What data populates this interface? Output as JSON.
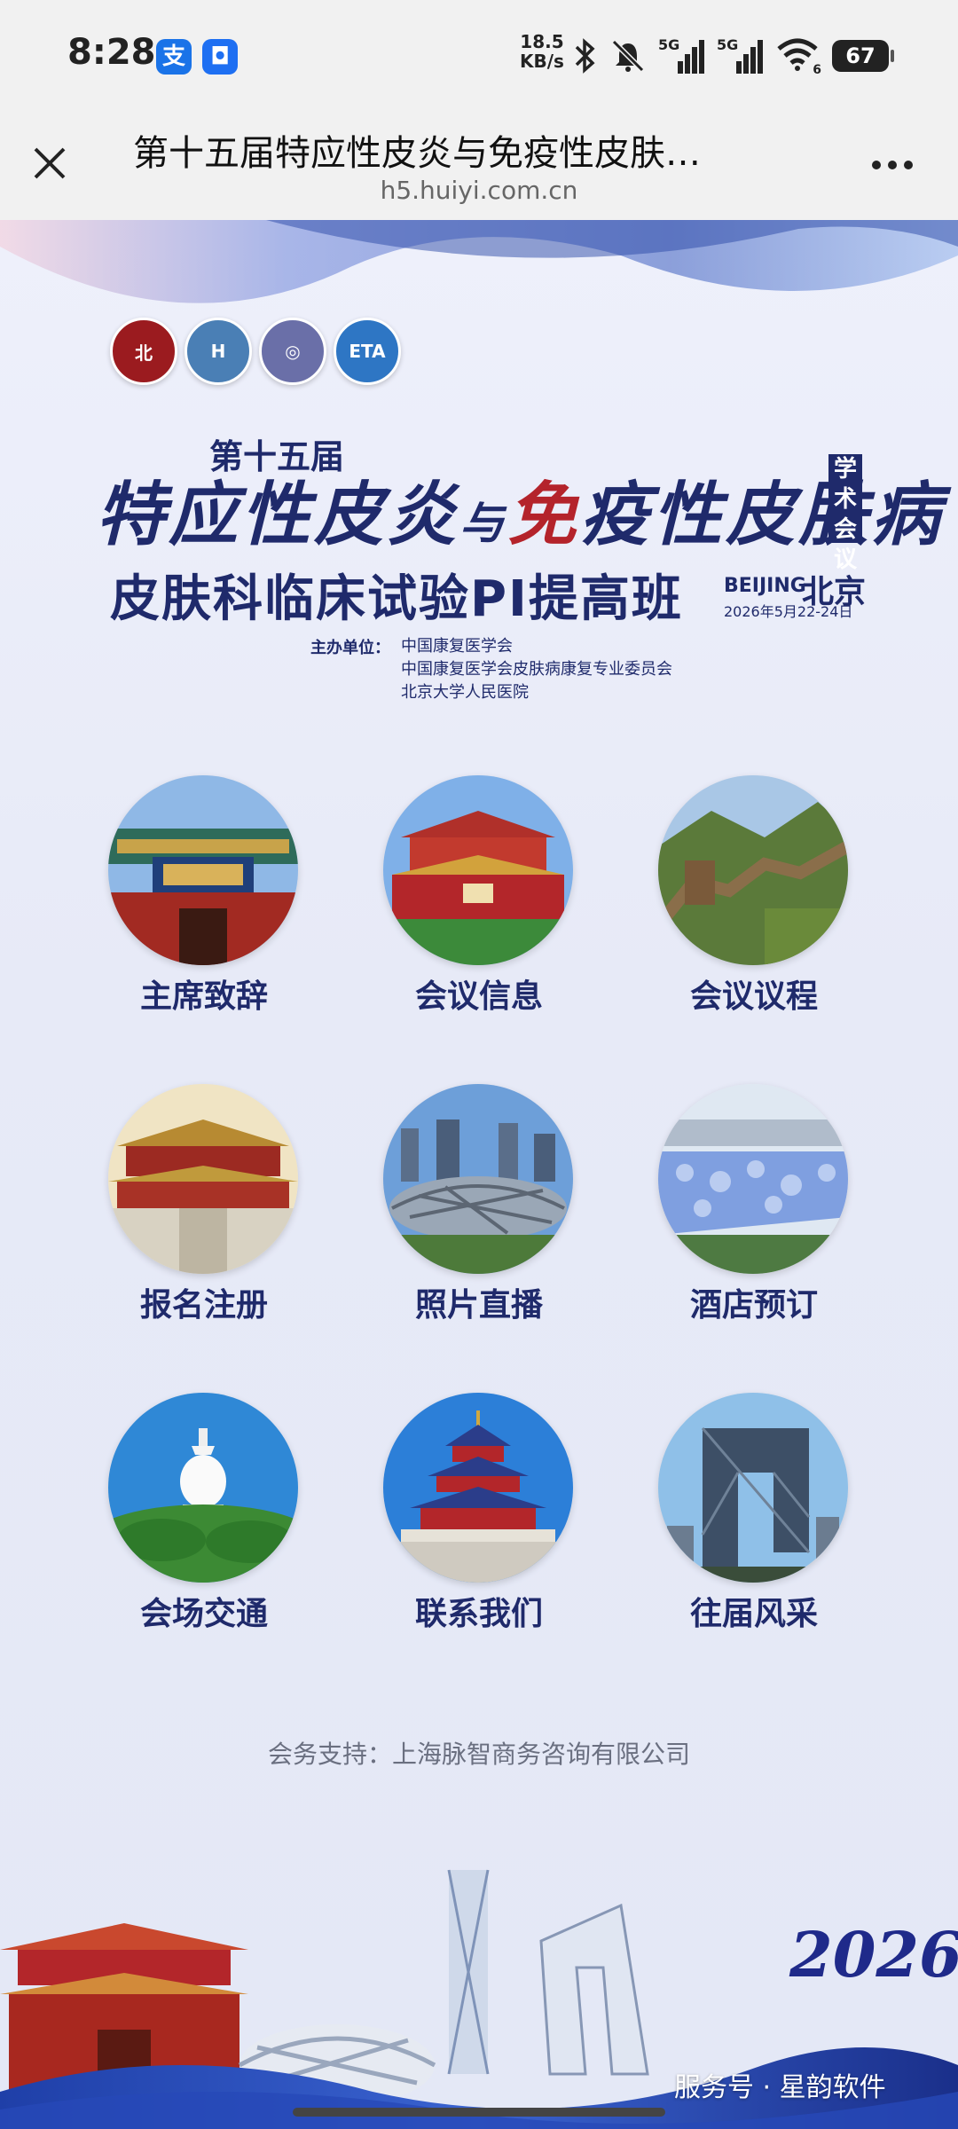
{
  "status_bar": {
    "time": "8:28",
    "app_icons": [
      "alipay-icon",
      "shield-app-icon"
    ],
    "net_speed_value": "18.5",
    "net_speed_unit": "KB/s",
    "network_1": "5G",
    "network_2": "5G",
    "wifi_sub": "6",
    "battery": "67"
  },
  "nav": {
    "title": "第十五届特应性皮炎与免疫性皮肤…",
    "url": "h5.huiyi.com.cn"
  },
  "banner": {
    "edition": "第十五届",
    "title_part1": "特应性皮炎",
    "title_connector": "与",
    "title_part2_first": "免",
    "title_part2_rest": "疫性皮肤病",
    "badge": "学术会议",
    "subtitle": "皮肤科临床试验PI提高班",
    "city_en": "BEIJING",
    "city_cn": "北京",
    "date": "2026年5月22-24日",
    "organizers_label": "主办单位：",
    "organizers": [
      "中国康复医学会",
      "中国康复医学会皮肤病康复专业委员会",
      "北京大学人民医院"
    ]
  },
  "menu": [
    {
      "label": "主席致辞",
      "scene": "peking-university-gate"
    },
    {
      "label": "会议信息",
      "scene": "tiananmen"
    },
    {
      "label": "会议议程",
      "scene": "great-wall"
    },
    {
      "label": "报名注册",
      "scene": "forbidden-city"
    },
    {
      "label": "照片直播",
      "scene": "birds-nest"
    },
    {
      "label": "酒店预订",
      "scene": "water-cube"
    },
    {
      "label": "会场交通",
      "scene": "white-pagoda"
    },
    {
      "label": "联系我们",
      "scene": "temple-of-heaven"
    },
    {
      "label": "往届风采",
      "scene": "cctv-tower"
    }
  ],
  "footer": {
    "support": "会务支持：上海脉智商务咨询有限公司",
    "year_art": "2026",
    "watermark": "服务号 · 星韵软件"
  },
  "colors": {
    "navy": "#1f2a6b",
    "red": "#b4232b",
    "page_bg": "#e7eaf7"
  }
}
